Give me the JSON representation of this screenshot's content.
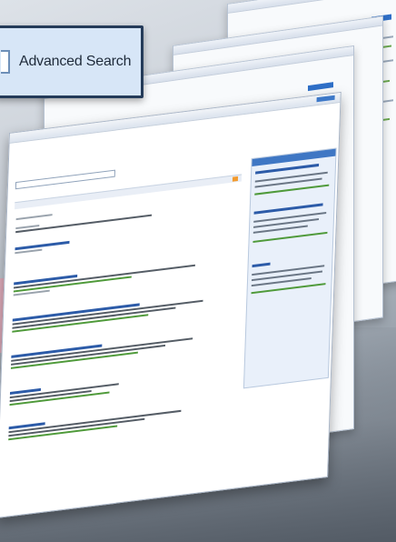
{
  "advanced_search": {
    "label": "Advanced Search"
  },
  "front_window": {
    "search_placeholder": "",
    "results_header": "",
    "options_label": "",
    "more_link": ""
  },
  "colors": {
    "accent_blue": "#3f77c4",
    "frame_dark": "#243b59",
    "link_green": "#4f9a3a",
    "rss_orange": "#f29b2f"
  }
}
